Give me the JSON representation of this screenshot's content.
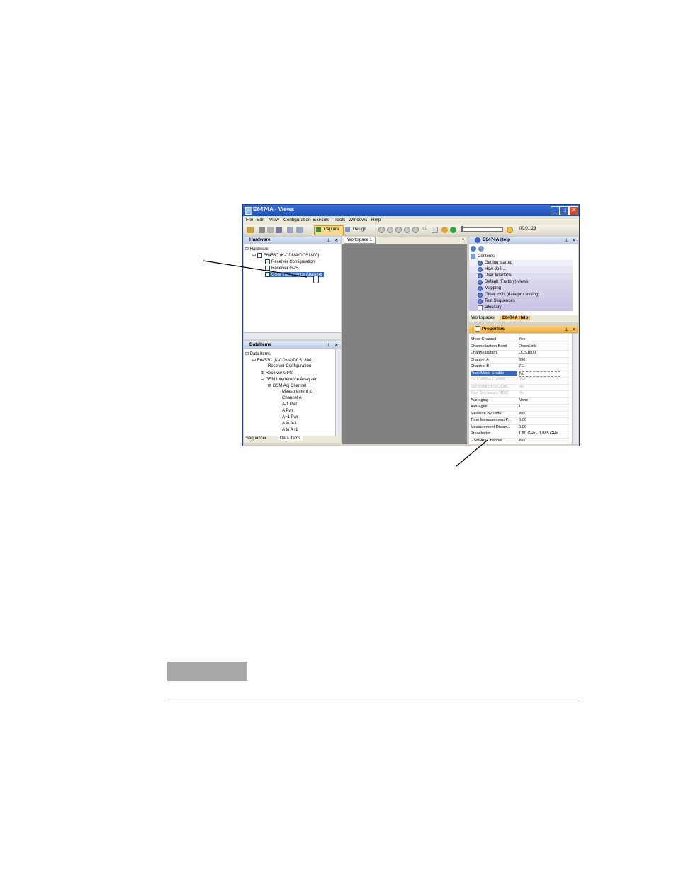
{
  "window": {
    "title": "E6474A - Views",
    "minimize": "_",
    "maximize": "□",
    "close": "✕"
  },
  "menu": [
    "File",
    "Edit",
    "View",
    "Configuration",
    "Execute",
    "Tools",
    "Windows",
    "Help"
  ],
  "toolbar": {
    "capture_label": "Capture",
    "design_label": "Design",
    "step_value": "x1",
    "elapsed_time": "00:01:29"
  },
  "hardware": {
    "title": "Hardware",
    "root": "Hardware",
    "device": "E6453C (K-CDMA/DCS1800)",
    "children": [
      "Receiver Configuration",
      "Receiver GPS",
      "GSM Interference Analyzer"
    ]
  },
  "dataitems": {
    "title": "DataItems",
    "root": "Data Items",
    "device": "E6453C (K-CDMA/DCS1800)",
    "receiver_config": "Receiver Configuration",
    "receiver_gps": "Receiver GPS",
    "gsm_analyzer": "GSM Interference Analyzer",
    "adj_channel": "GSM Adj Channel",
    "leaves": [
      "Measurement Id",
      "Channel A",
      "A-1 Pwr",
      "A Pwr",
      "A+1 Pwr",
      "A to A-1",
      "A to A+1"
    ],
    "tabs": [
      "Sequencer",
      "Data Items"
    ]
  },
  "workspace": {
    "tab": "Workspace 1"
  },
  "help": {
    "title": "E6474A Help",
    "contents": "Contents",
    "items": [
      "Getting started",
      "How do I ...",
      "User Interface",
      "Default (Factory) views",
      "Mapping",
      "Other tools (data processing)",
      "Test Sequences",
      "Glossary"
    ],
    "tabs": [
      "Workspaces",
      "E6474A Help"
    ]
  },
  "properties": {
    "title": "Properties",
    "rows": [
      {
        "name": "Show Channel",
        "value": "Yes"
      },
      {
        "name": "Channelization Band",
        "value": "DownLink"
      },
      {
        "name": "Channelization",
        "value": "DCS1800"
      },
      {
        "name": "Channel A",
        "value": "696"
      },
      {
        "name": "Channel B",
        "value": "711"
      },
      {
        "name": "Peak Mode Enable",
        "value": "No"
      },
      {
        "name": "Co Channel Carrier",
        "value": "690"
      },
      {
        "name": "Secondary BSIC Dec...",
        "value": "No"
      },
      {
        "name": "Fast Secondary BSIC",
        "value": "No"
      },
      {
        "name": "Averaging",
        "value": "None"
      },
      {
        "name": "Averages",
        "value": "1"
      },
      {
        "name": "Measure By Time",
        "value": "Yes"
      },
      {
        "name": "Time Measurement P...",
        "value": "0.00"
      },
      {
        "name": "Measurement Distan...",
        "value": "0.00"
      },
      {
        "name": "Preselector",
        "value": "1.80 GHz - 1.885 GHz"
      },
      {
        "name": "GSM Adj Channel",
        "value": "Yes"
      }
    ]
  }
}
